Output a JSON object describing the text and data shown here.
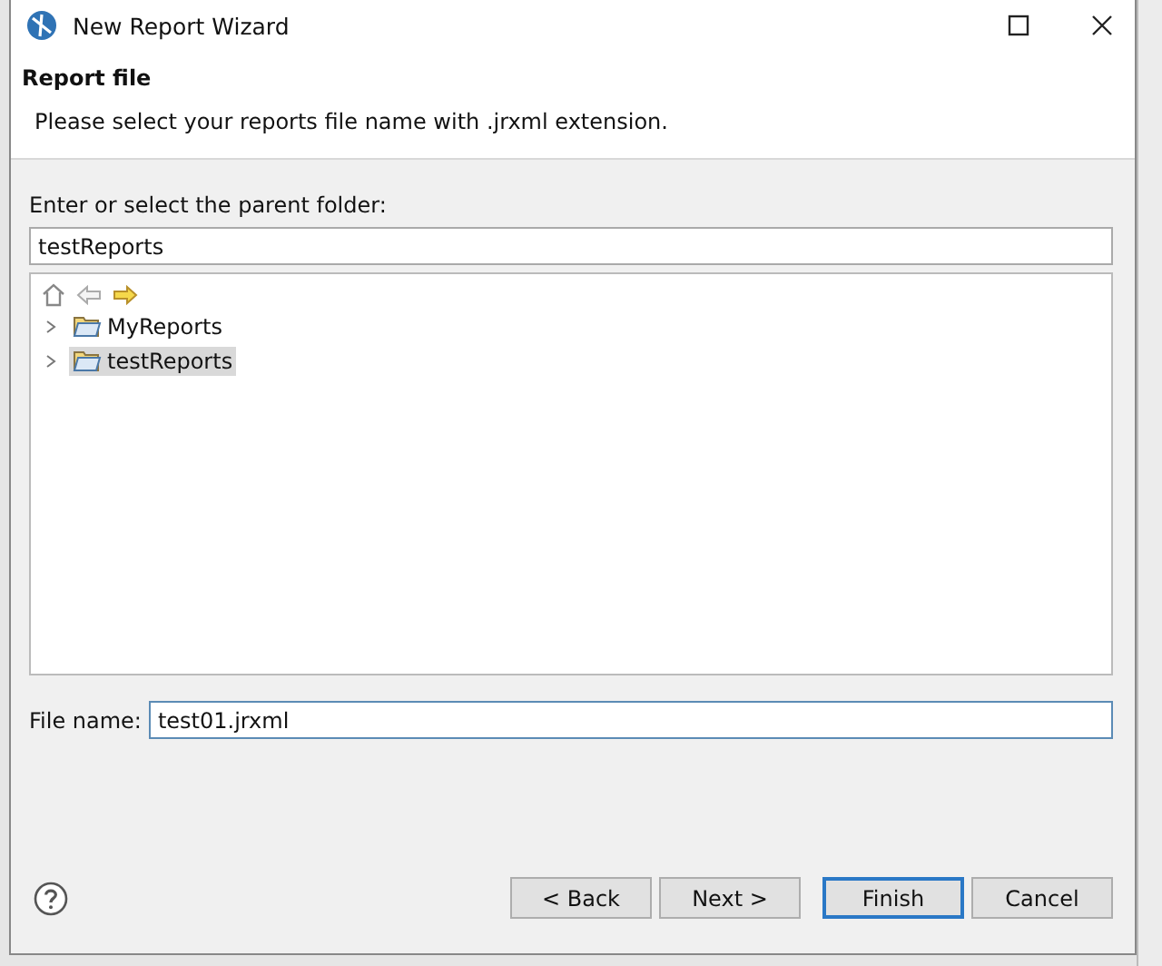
{
  "window": {
    "title": "New Report Wizard"
  },
  "header": {
    "title": "Report file",
    "description": "Please select your reports file name with .jrxml extension."
  },
  "parent_folder": {
    "label": "Enter or select the parent folder:",
    "value": "testReports"
  },
  "tree": {
    "items": [
      {
        "label": "MyReports",
        "expanded": false,
        "selected": false
      },
      {
        "label": "testReports",
        "expanded": false,
        "selected": true
      }
    ]
  },
  "file_name": {
    "label": "File name:",
    "value": "test01.jrxml"
  },
  "buttons": [
    {
      "label": "< Back",
      "default": false
    },
    {
      "label": "Next >",
      "default": false
    },
    {
      "label": "Finish",
      "default": true
    },
    {
      "label": "Cancel",
      "default": false
    }
  ]
}
